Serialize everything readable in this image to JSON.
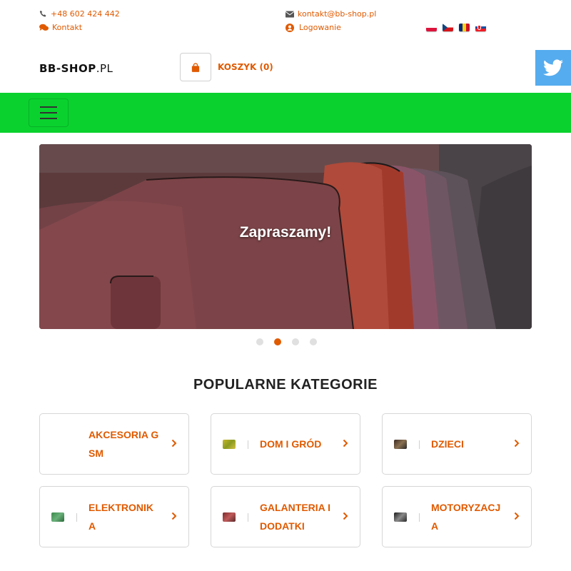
{
  "topbar": {
    "phone": "+48 602 424 442",
    "contact_link": "Kontakt",
    "email": "kontakt@bb-shop.pl",
    "login_link": "Logowanie",
    "flags": [
      "pl",
      "cz",
      "ro",
      "sk"
    ]
  },
  "header": {
    "logo_main": "BB-SHOP",
    "logo_tld": ".PL",
    "cart_label": "KOSZYK (0)",
    "social_icon": "twitter-icon"
  },
  "navbar": {
    "menu_icon": "hamburger-menu-icon",
    "color": "#0ad12e"
  },
  "carousel": {
    "caption": "Zapraszamy!",
    "slide_count": 4,
    "active_slide": 2
  },
  "categories": {
    "title": "POPULARNE KATEGORIE",
    "items": [
      {
        "label": "AKCESORIA GSM",
        "icon": "none"
      },
      {
        "label": "DOM I GRÓD",
        "icon": "home-garden-thumbnail"
      },
      {
        "label": "DZIECI",
        "icon": "kids-thumbnail"
      },
      {
        "label": "ELEKTRONIKA",
        "icon": "electronics-thumbnail"
      },
      {
        "label": "GALANTERIA I DODATKI",
        "icon": "accessories-thumbnail"
      },
      {
        "label": "MOTORYZACJA",
        "icon": "automotive-thumbnail"
      }
    ]
  },
  "colors": {
    "accent": "#e05a00",
    "nav": "#0ad12e",
    "twitter": "#55acee"
  }
}
